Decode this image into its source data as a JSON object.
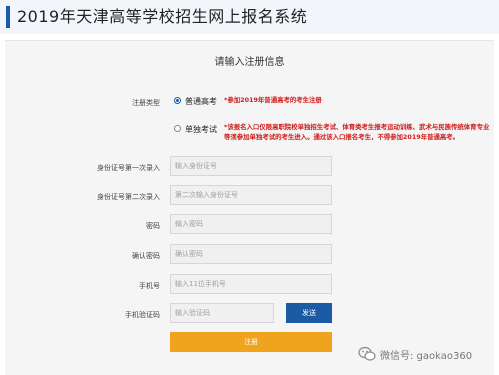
{
  "header": {
    "title": "2019年天津高等学校招生网上报名系统"
  },
  "form": {
    "title": "请输入注册信息",
    "registration_type": {
      "label": "注册类型",
      "options": [
        {
          "label": "普通高考",
          "note": "*参加2019年普通高考的考生注册",
          "checked": true
        },
        {
          "label": "单独考试",
          "note": "*该报名入口仅限高职院校单独招生考试、体育类考生报考运动训练、武术与民族传统体育专业等须参加单独考试的考生进入。通过该入口报名考生，不得参加2019年普通高考。",
          "checked": false
        }
      ]
    },
    "fields": [
      {
        "label": "身份证号第一次录入",
        "placeholder": "输入身份证号"
      },
      {
        "label": "身份证号第二次录入",
        "placeholder": "第二次输入身份证号"
      },
      {
        "label": "密码",
        "placeholder": "输入密码"
      },
      {
        "label": "确认密码",
        "placeholder": "确认密码"
      },
      {
        "label": "手机号",
        "placeholder": "输入11位手机号"
      },
      {
        "label": "手机验证码",
        "placeholder": "输入验证码"
      }
    ],
    "send_button": "发送",
    "submit_button": "注册"
  },
  "watermark": {
    "text": "微信号: gaokao360",
    "icon": "wechat-icon"
  },
  "colors": {
    "accent": "#1b5aa5",
    "submit": "#f0a31c",
    "note": "#d11a1a"
  }
}
